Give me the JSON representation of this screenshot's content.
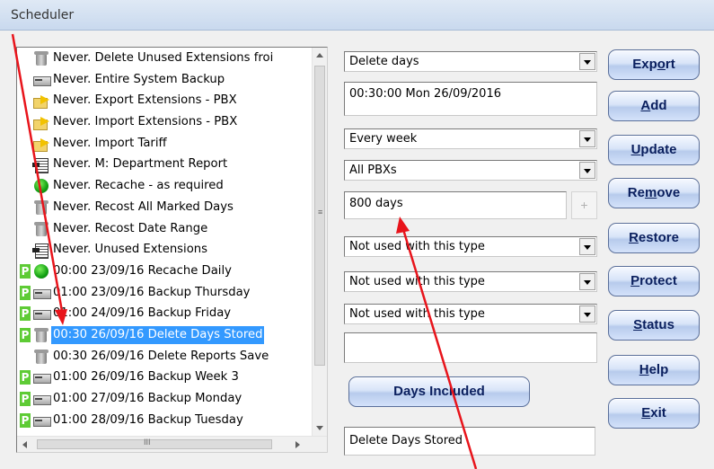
{
  "window": {
    "title": "Scheduler"
  },
  "schedule_list": {
    "rows": [
      {
        "p": false,
        "icon": "recycle-bin-icon",
        "text": "Never.  Delete Unused Extensions froi"
      },
      {
        "p": false,
        "icon": "drive-icon",
        "text": "Never.  Entire System Backup"
      },
      {
        "p": false,
        "icon": "export-folder-icon",
        "text": "Never.  Export Extensions - PBX"
      },
      {
        "p": false,
        "icon": "export-folder-icon",
        "text": "Never.  Import Extensions - PBX"
      },
      {
        "p": false,
        "icon": "export-folder-icon",
        "text": "Never.  Import Tariff"
      },
      {
        "p": false,
        "icon": "report-icon",
        "text": "Never.  M: Department Report"
      },
      {
        "p": false,
        "icon": "globe-icon",
        "text": "Never.  Recache - as required"
      },
      {
        "p": false,
        "icon": "recycle-bin-icon",
        "text": "Never.  Recost All Marked Days"
      },
      {
        "p": false,
        "icon": "recycle-bin-icon",
        "text": "Never.  Recost Date Range"
      },
      {
        "p": false,
        "icon": "report-icon",
        "text": "Never.  Unused Extensions"
      },
      {
        "p": true,
        "icon": "globe-icon",
        "text": "00:00 23/09/16 Recache Daily"
      },
      {
        "p": true,
        "icon": "drive-icon",
        "text": "01:00 23/09/16 Backup Thursday"
      },
      {
        "p": true,
        "icon": "drive-icon",
        "text": "01:00 24/09/16 Backup Friday"
      },
      {
        "p": true,
        "icon": "recycle-bin-icon",
        "text": "00:30 26/09/16 Delete Days Stored",
        "selected": true
      },
      {
        "p": false,
        "icon": "recycle-bin-icon",
        "text": "00:30 26/09/16 Delete Reports Save"
      },
      {
        "p": true,
        "icon": "drive-icon",
        "text": "01:00 26/09/16 Backup Week 3"
      },
      {
        "p": true,
        "icon": "drive-icon",
        "text": "01:00 27/09/16 Backup Monday"
      },
      {
        "p": true,
        "icon": "drive-icon",
        "text": "01:00 28/09/16 Backup Tuesday"
      }
    ],
    "p_label": "P",
    "hscroll_grip": "III",
    "vscroll_grip": "≡"
  },
  "form": {
    "task_type": "Delete days",
    "next_run": "00:30:00 Mon 26/09/2016",
    "frequency": "Every week",
    "pbx_scope": "All PBXs",
    "days_value": "800 days",
    "spin_label": "+",
    "option1": "Not used with this type",
    "option2": "Not used with this type",
    "option3": "Not used with this type",
    "blank_field": "",
    "days_included_label": "Days Included",
    "description": "Delete Days Stored"
  },
  "buttons": {
    "export": {
      "before": "Exp",
      "key": "o",
      "after": "rt"
    },
    "add": {
      "before": "",
      "key": "A",
      "after": "dd"
    },
    "update": {
      "before": "",
      "key": "U",
      "after": "pdate"
    },
    "remove": {
      "before": "Re",
      "key": "m",
      "after": "ove"
    },
    "restore": {
      "before": "",
      "key": "R",
      "after": "estore"
    },
    "protect": {
      "before": "",
      "key": "P",
      "after": "rotect"
    },
    "status": {
      "before": "",
      "key": "S",
      "after": "tatus"
    },
    "help": {
      "before": "",
      "key": "H",
      "after": "elp"
    },
    "exit": {
      "before": "",
      "key": "E",
      "after": "xit"
    }
  },
  "colors": {
    "selection": "#3399ff",
    "p_marker": "#5ecb35",
    "annotation": "#e8141b",
    "button_text": "#0a1f5e"
  }
}
